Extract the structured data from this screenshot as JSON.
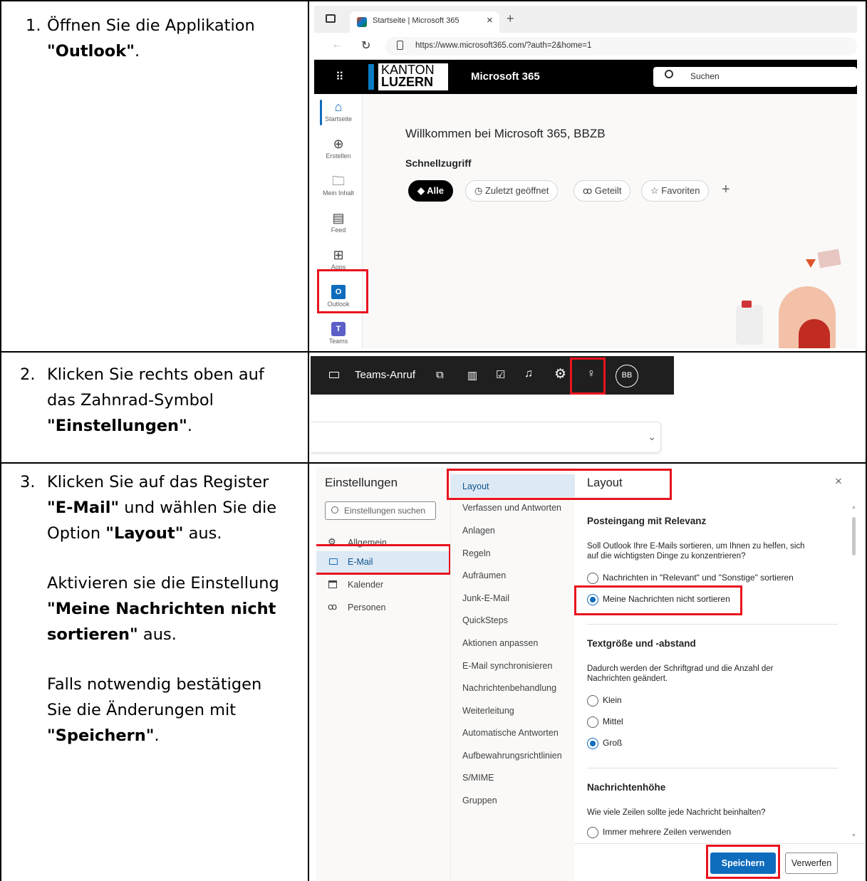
{
  "steps": [
    {
      "num": "1.",
      "line1": "Öffnen Sie die Applikation",
      "bold": "\"Outlook\"",
      "tail": "."
    },
    {
      "num": "2.",
      "line1": "Klicken Sie rechts oben auf",
      "line2": "das Zahnrad-Symbol",
      "bold": "\"Einstellungen\"",
      "tail": "."
    },
    {
      "num": "3.",
      "line1": "Klicken Sie auf das Register",
      "bold1": "\"E-Mail\"",
      "mid1": " und wählen Sie die",
      "pre2": "Option ",
      "bold2": "\"Layout\"",
      "tail2": " aus.",
      "p2_line1": "Aktivieren sie die Einstellung",
      "p2_bold1": "\"Meine Nachrichten nicht",
      "p2_bold2": "sortieren\"",
      "p2_tail": " aus.",
      "p3_line1": "Falls notwendig bestätigen",
      "p3_line2": "Sie die Änderungen mit",
      "p3_bold": "\"Speichern\"",
      "p3_tail": "."
    }
  ],
  "shot1": {
    "tab_title": "Startseite | Microsoft 365",
    "tab_close": "×",
    "tab_add": "+",
    "url": "https://www.microsoft365.com/?auth=2&home=1",
    "logo_line1": "KANTON",
    "logo_line2": "LUZERN",
    "app_name": "Microsoft 365",
    "search_placeholder": "Suchen",
    "rail": [
      "Startseite",
      "Erstellen",
      "Mein Inhalt",
      "Feed",
      "Apps",
      "Outlook",
      "Teams"
    ],
    "welcome": "Willkommen bei Microsoft 365, BBZB",
    "quick_access": "Schnellzugriff",
    "pills": [
      "Alle",
      "Zuletzt geöffnet",
      "Geteilt",
      "Favoriten"
    ],
    "pill_add": "+"
  },
  "shot2": {
    "call_label": "Teams-Anruf",
    "avatar": "BB",
    "chevron": "⌄"
  },
  "shot3": {
    "title": "Einstellungen",
    "search_placeholder": "Einstellungen suchen",
    "categories": [
      "Allgemein",
      "E-Mail",
      "Kalender",
      "Personen"
    ],
    "subnav": [
      "Layout",
      "Verfassen und Antworten",
      "Anlagen",
      "Regeln",
      "Aufräumen",
      "Junk-E-Mail",
      "QuickSteps",
      "Aktionen anpassen",
      "E-Mail synchronisieren",
      "Nachrichtenbehandlung",
      "Weiterleitung",
      "Automatische Antworten",
      "Aufbewahrungsrichtlinien",
      "S/MIME",
      "Gruppen"
    ],
    "pane_title": "Layout",
    "close": "×",
    "focused_head": "Posteingang mit Relevanz",
    "focused_desc1": "Soll Outlook Ihre E-Mails sortieren, um Ihnen zu helfen, sich",
    "focused_desc2": "auf die wichtigsten Dinge zu konzentrieren?",
    "focused_opt1": "Nachrichten in \"Relevant\" und \"Sonstige\" sortieren",
    "focused_opt2": "Meine Nachrichten nicht sortieren",
    "text_head": "Textgröße und -abstand",
    "text_desc1": "Dadurch werden der Schriftgrad und die Anzahl der",
    "text_desc2": "Nachrichten geändert.",
    "size_opts": [
      "Klein",
      "Mittel",
      "Groß"
    ],
    "height_head": "Nachrichtenhöhe",
    "height_desc": "Wie viele Zeilen sollte jede Nachricht beinhalten?",
    "height_opt1": "Immer mehrere Zeilen verwenden",
    "save": "Speichern",
    "discard": "Verwerfen"
  }
}
